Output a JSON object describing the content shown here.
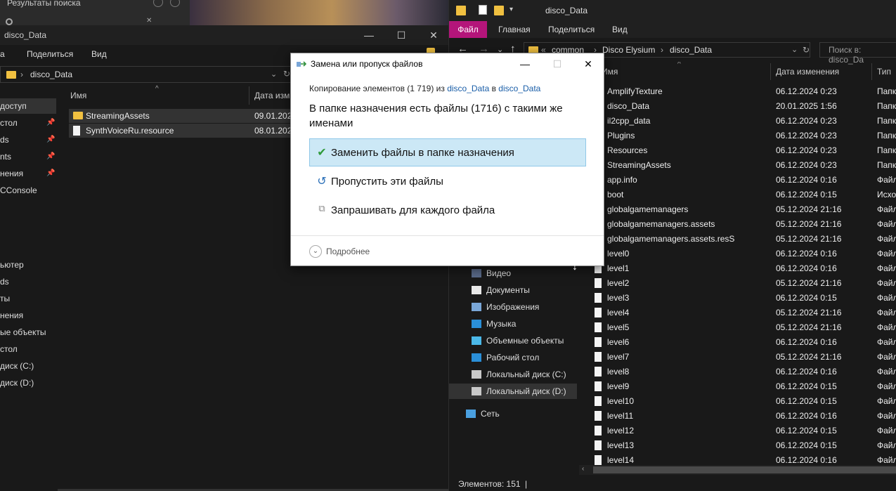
{
  "top_search": {
    "label": "Результаты поиска"
  },
  "left_window": {
    "title": "disco_Data",
    "ribbon": [
      "а",
      "Поделиться",
      "Вид"
    ],
    "address": "disco_Data",
    "nav": [
      {
        "label": "доступ",
        "pinned": false,
        "selected": true
      },
      {
        "label": "стол",
        "pinned": true
      },
      {
        "label": "ds",
        "pinned": true
      },
      {
        "label": "nts",
        "pinned": true
      },
      {
        "label": "нения",
        "pinned": true
      },
      {
        "label": "CConsole",
        "pinned": false
      },
      {
        "label": "ьютер"
      },
      {
        "label": "ds"
      },
      {
        "label": "ты"
      },
      {
        "label": "нения"
      },
      {
        "label": "ые объекты"
      },
      {
        "label": "стол"
      },
      {
        "label": "диск (C:)"
      },
      {
        "label": "диск (D:)"
      }
    ],
    "columns": {
      "name": "Имя",
      "date": "Дата изм"
    },
    "files": [
      {
        "name": "StreamingAssets",
        "date": "09.01.2025",
        "type": "folder"
      },
      {
        "name": "SynthVoiceRu.resource",
        "date": "08.01.2025",
        "type": "file"
      }
    ]
  },
  "right_window": {
    "title": "disco_Data",
    "ribbon": {
      "file": "Файл",
      "tabs": [
        "Главная",
        "Поделиться",
        "Вид"
      ]
    },
    "breadcrumb": [
      "«",
      "common",
      "Disco Elysium",
      "disco_Data"
    ],
    "search_placeholder": "Поиск в: disco_Da",
    "columns": {
      "name": "Имя",
      "date": "Дата изменения",
      "type": "Тип"
    },
    "nav": [
      {
        "label": "Видео",
        "icon": "video-icon"
      },
      {
        "label": "Документы",
        "icon": "documents-icon"
      },
      {
        "label": "Изображения",
        "icon": "pictures-icon"
      },
      {
        "label": "Музыка",
        "icon": "music-icon"
      },
      {
        "label": "Объемные объекты",
        "icon": "3d-objects-icon"
      },
      {
        "label": "Рабочий стол",
        "icon": "desktop-icon"
      },
      {
        "label": "Локальный диск (C:)",
        "icon": "drive-icon"
      },
      {
        "label": "Локальный диск (D:)",
        "icon": "drive-icon",
        "selected": true
      },
      {
        "label": "Сеть",
        "icon": "network-icon"
      }
    ],
    "files": [
      {
        "name": "AmplifyTexture",
        "date": "06.12.2024 0:23",
        "type": "Папк"
      },
      {
        "name": "disco_Data",
        "date": "20.01.2025 1:56",
        "type": "Папк"
      },
      {
        "name": "il2cpp_data",
        "date": "06.12.2024 0:23",
        "type": "Папк"
      },
      {
        "name": "Plugins",
        "date": "06.12.2024 0:23",
        "type": "Папк"
      },
      {
        "name": "Resources",
        "date": "06.12.2024 0:23",
        "type": "Папк"
      },
      {
        "name": "StreamingAssets",
        "date": "06.12.2024 0:23",
        "type": "Папк"
      },
      {
        "name": "app.info",
        "date": "06.12.2024 0:16",
        "type": "Файл"
      },
      {
        "name": "boot",
        "date": "06.12.2024 0:15",
        "type": "Исхо"
      },
      {
        "name": "globalgamemanagers",
        "date": "05.12.2024 21:16",
        "type": "Файл"
      },
      {
        "name": "globalgamemanagers.assets",
        "date": "05.12.2024 21:16",
        "type": "Файл"
      },
      {
        "name": "globalgamemanagers.assets.resS",
        "date": "05.12.2024 21:16",
        "type": "Файл"
      },
      {
        "name": "level0",
        "date": "06.12.2024 0:16",
        "type": "Файл"
      },
      {
        "name": "level1",
        "date": "06.12.2024 0:16",
        "type": "Файл"
      },
      {
        "name": "level2",
        "date": "05.12.2024 21:16",
        "type": "Файл"
      },
      {
        "name": "level3",
        "date": "06.12.2024 0:15",
        "type": "Файл"
      },
      {
        "name": "level4",
        "date": "05.12.2024 21:16",
        "type": "Файл"
      },
      {
        "name": "level5",
        "date": "05.12.2024 21:16",
        "type": "Файл"
      },
      {
        "name": "level6",
        "date": "06.12.2024 0:16",
        "type": "Файл"
      },
      {
        "name": "level7",
        "date": "05.12.2024 21:16",
        "type": "Файл"
      },
      {
        "name": "level8",
        "date": "06.12.2024 0:16",
        "type": "Файл"
      },
      {
        "name": "level9",
        "date": "06.12.2024 0:15",
        "type": "Файл"
      },
      {
        "name": "level10",
        "date": "06.12.2024 0:15",
        "type": "Файл"
      },
      {
        "name": "level11",
        "date": "06.12.2024 0:16",
        "type": "Файл"
      },
      {
        "name": "level12",
        "date": "06.12.2024 0:15",
        "type": "Файл"
      },
      {
        "name": "level13",
        "date": "06.12.2024 0:15",
        "type": "Файл"
      },
      {
        "name": "level14",
        "date": "06.12.2024 0:16",
        "type": "Файл"
      }
    ],
    "status": "Элементов: 151"
  },
  "dialog": {
    "title": "Замена или пропуск файлов",
    "copy_prefix": "Копирование элементов (1 719) из ",
    "copy_src": "disco_Data",
    "copy_mid": " в ",
    "copy_dst": "disco_Data",
    "message": "В папке назначения есть файлы (1716) с такими же именами",
    "options": [
      {
        "label": "Заменить файлы в папке назначения",
        "icon": "checkmark-icon",
        "highlighted": true
      },
      {
        "label": "Пропустить эти файлы",
        "icon": "skip-icon"
      },
      {
        "label": "Запрашивать для каждого файла",
        "icon": "compare-icon"
      }
    ],
    "details": "Подробнее"
  },
  "colors": {
    "accent_file_tab": "#b4157a",
    "folder": "#f0c040",
    "dialog_highlight": "#cce8f6",
    "link": "#1a5ea8"
  }
}
